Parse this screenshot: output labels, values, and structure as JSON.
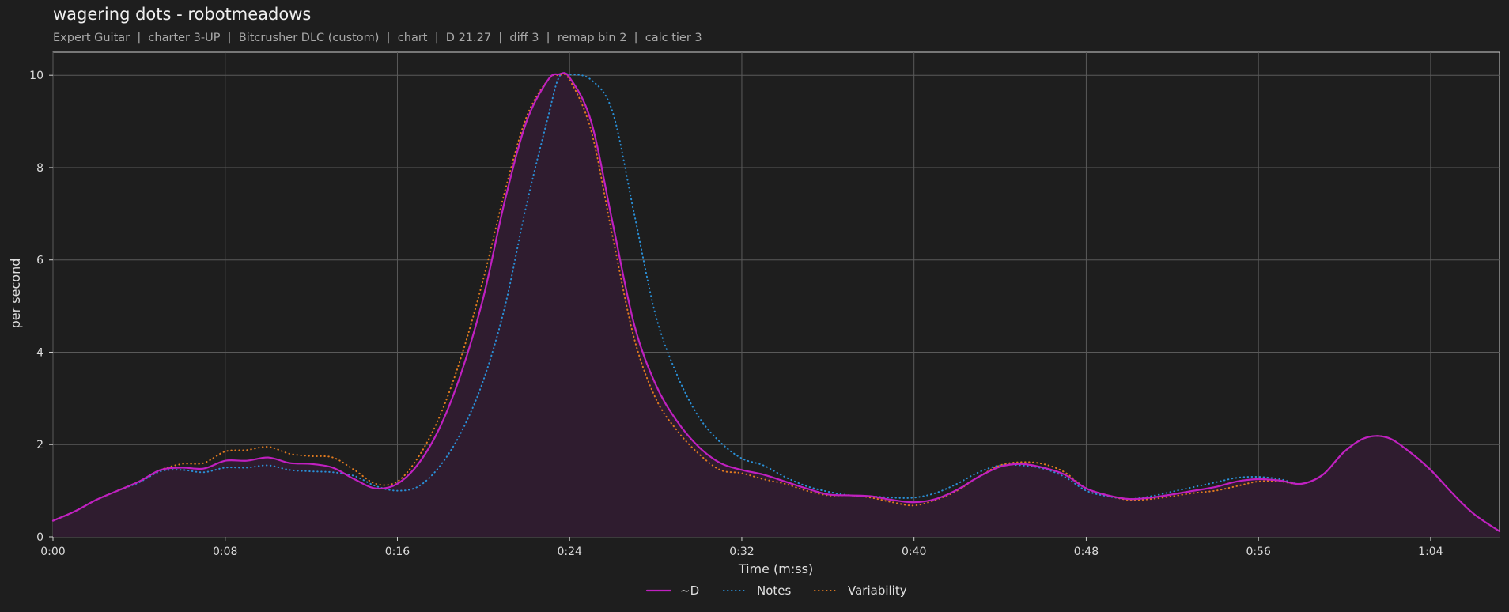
{
  "title": "wagering dots - robotmeadows",
  "subtitle": "Expert Guitar  |  charter 3-UP  |  Bitcrusher DLC (custom)  |  chart  |  D 21.27  |  diff 3  |  remap bin 2  |  calc tier 3",
  "chart_data": {
    "type": "line",
    "xlabel": "Time (m:ss)",
    "ylabel": "per second",
    "xlim": [
      0,
      67.2
    ],
    "ylim": [
      0,
      10.5
    ],
    "x_ticks": [
      0,
      8,
      16,
      24,
      32,
      40,
      48,
      56,
      64
    ],
    "x_tick_labels": [
      "0:00",
      "0:08",
      "0:16",
      "0:24",
      "0:32",
      "0:40",
      "0:48",
      "0:56",
      "1:04"
    ],
    "y_ticks": [
      0,
      2,
      4,
      6,
      8,
      10
    ],
    "y_tick_labels": [
      "0",
      "2",
      "4",
      "6",
      "8",
      "10"
    ],
    "grid": true,
    "legend_position": "bottom-center",
    "x": [
      0,
      1,
      2,
      3,
      4,
      5,
      6,
      7,
      8,
      9,
      10,
      11,
      12,
      13,
      14,
      15,
      16,
      17,
      18,
      19,
      20,
      21,
      22,
      23,
      23.5,
      24,
      25,
      26,
      27,
      28,
      29,
      30,
      31,
      32,
      33,
      34,
      35,
      36,
      37,
      38,
      39,
      40,
      41,
      42,
      43,
      44,
      45,
      46,
      47,
      48,
      49,
      50,
      51,
      52,
      53,
      54,
      55,
      56,
      57,
      58,
      59,
      60,
      61,
      62,
      63,
      64,
      65,
      66,
      67.2
    ],
    "series": [
      {
        "name": "~D",
        "color": "#c020c0",
        "style": "solid",
        "fill": "#2f1c2f",
        "values": [
          0.35,
          0.55,
          0.8,
          1.0,
          1.2,
          1.45,
          1.5,
          1.48,
          1.65,
          1.65,
          1.72,
          1.6,
          1.58,
          1.5,
          1.25,
          1.05,
          1.15,
          1.6,
          2.4,
          3.6,
          5.2,
          7.3,
          9.0,
          9.9,
          10.02,
          9.95,
          9.0,
          6.8,
          4.6,
          3.3,
          2.5,
          1.95,
          1.6,
          1.45,
          1.35,
          1.2,
          1.05,
          0.92,
          0.9,
          0.88,
          0.8,
          0.75,
          0.82,
          1.02,
          1.3,
          1.52,
          1.58,
          1.5,
          1.35,
          1.05,
          0.9,
          0.82,
          0.85,
          0.92,
          1.0,
          1.08,
          1.2,
          1.25,
          1.22,
          1.15,
          1.35,
          1.85,
          2.15,
          2.15,
          1.85,
          1.45,
          0.95,
          0.5,
          0.12
        ]
      },
      {
        "name": "Notes",
        "color": "#2a8fd6",
        "style": "dotted",
        "values": [
          0.35,
          0.55,
          0.8,
          1.0,
          1.18,
          1.42,
          1.45,
          1.4,
          1.5,
          1.5,
          1.55,
          1.45,
          1.42,
          1.4,
          1.32,
          1.1,
          1.0,
          1.1,
          1.55,
          2.3,
          3.4,
          5.0,
          7.2,
          9.1,
          9.95,
          10.02,
          9.9,
          9.2,
          7.0,
          4.8,
          3.5,
          2.6,
          2.05,
          1.7,
          1.55,
          1.3,
          1.1,
          0.98,
          0.9,
          0.88,
          0.85,
          0.85,
          0.95,
          1.15,
          1.4,
          1.55,
          1.55,
          1.48,
          1.3,
          1.0,
          0.88,
          0.82,
          0.88,
          0.98,
          1.08,
          1.18,
          1.28,
          1.3,
          1.25,
          1.15,
          1.35,
          1.85,
          2.15,
          2.15,
          1.85,
          1.45,
          0.95,
          0.5,
          0.12
        ]
      },
      {
        "name": "Variability",
        "color": "#e07a1f",
        "style": "dotted",
        "values": [
          0.35,
          0.55,
          0.8,
          1.0,
          1.2,
          1.45,
          1.58,
          1.6,
          1.85,
          1.88,
          1.95,
          1.8,
          1.75,
          1.72,
          1.45,
          1.15,
          1.2,
          1.75,
          2.65,
          3.95,
          5.6,
          7.5,
          9.1,
          9.9,
          10.0,
          9.9,
          8.8,
          6.5,
          4.3,
          3.0,
          2.3,
          1.8,
          1.45,
          1.38,
          1.25,
          1.15,
          1.0,
          0.9,
          0.9,
          0.85,
          0.75,
          0.68,
          0.8,
          1.0,
          1.3,
          1.55,
          1.62,
          1.58,
          1.4,
          1.05,
          0.9,
          0.8,
          0.82,
          0.88,
          0.95,
          1.0,
          1.1,
          1.2,
          1.2,
          1.15,
          1.35,
          1.85,
          2.15,
          2.15,
          1.85,
          1.45,
          0.95,
          0.5,
          0.12
        ]
      }
    ]
  }
}
